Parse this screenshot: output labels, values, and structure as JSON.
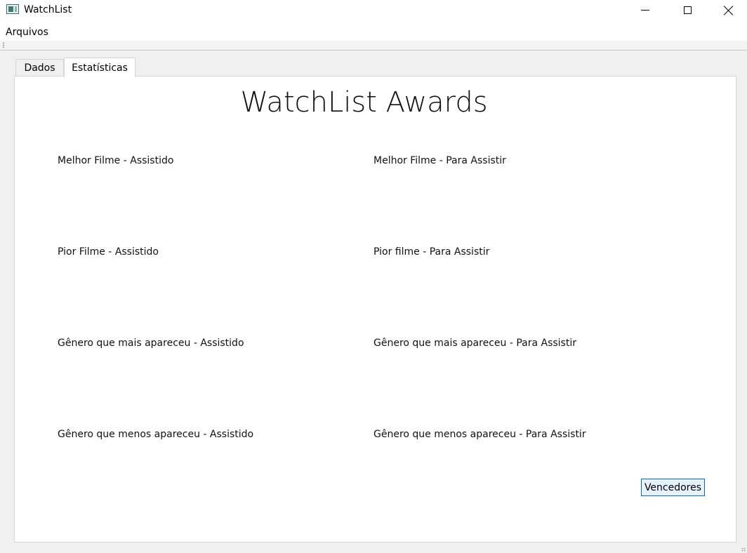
{
  "window": {
    "title": "WatchList",
    "icon": "app-window-icon",
    "controls": [
      "minimize-icon",
      "maximize-icon",
      "close-icon"
    ]
  },
  "menu": {
    "items": [
      {
        "label": "Arquivos"
      }
    ]
  },
  "tabs": [
    {
      "label": "Dados",
      "selected": false
    },
    {
      "label": "Estatísticas",
      "selected": true
    }
  ],
  "stats_panel": {
    "title": "WatchList Awards",
    "awards": {
      "best_watched": "Melhor Filme - Assistido",
      "best_to_watch": "Melhor Filme - Para Assistir",
      "worst_watched": "Pior Filme - Assistido",
      "worst_to_watch": "Pior filme - Para Assistir",
      "genre_most_watched": "Gênero que mais apareceu - Assistido",
      "genre_most_to_watch": "Gênero que mais apareceu - Para Assistir",
      "genre_least_watched": "Gênero que menos apareceu - Assistido",
      "genre_least_to_watch": "Gênero que menos apareceu - Para Assistir"
    },
    "winners_button": "Vencedores"
  },
  "colors": {
    "button_border": "#0a68c4",
    "button_fill": "#e5f1fb",
    "panel_bg": "#ffffff",
    "window_bg": "#f0f0f0"
  }
}
